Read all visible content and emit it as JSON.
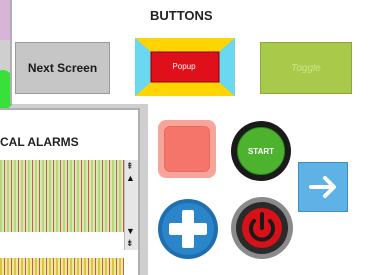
{
  "buttons_panel": {
    "title": "BUTTONS",
    "next_screen": "Next Screen",
    "popup": "Popup",
    "toggle": "Toggle"
  },
  "alarms_panel": {
    "title": "CAL ALARMS"
  },
  "controls": {
    "start": "START"
  },
  "icons": {
    "plus": "plus-icon",
    "power": "power-icon",
    "arrow": "arrow-right-icon",
    "scroll": "scroll-arrows-icon"
  },
  "colors": {
    "toggle_green": "#a9c94a",
    "start_green": "#4db32f",
    "popup_red": "#e0101a",
    "popup_yellow": "#ffd400",
    "popup_cyan": "#33c9e8",
    "plus_blue": "#1f6fb0",
    "power_red": "#d81018",
    "arrow_blue": "#5fb2e6"
  }
}
